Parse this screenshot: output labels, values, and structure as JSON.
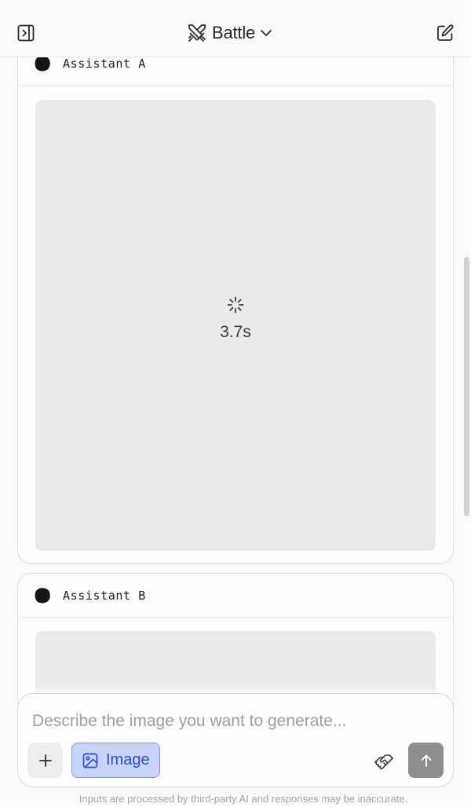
{
  "header": {
    "mode_label": "Battle",
    "icons": {
      "sidebar_toggle": "sidebar-toggle-icon",
      "mode": "crossed-swords-icon",
      "dropdown": "chevron-down-icon",
      "new_chat": "edit-square-icon"
    }
  },
  "responses": [
    {
      "model_name": "Assistant A",
      "status": "loading",
      "elapsed": "3.7s"
    },
    {
      "model_name": "Assistant B",
      "status": "loading"
    }
  ],
  "composer": {
    "placeholder": "Describe the image you want to generate...",
    "value": "",
    "image_mode_label": "Image",
    "image_mode_active": true,
    "icons": {
      "attach": "plus-icon",
      "image_mode": "image-icon",
      "feedback": "handshake-icon",
      "send": "arrow-up-icon"
    }
  },
  "footer": {
    "disclaimer": "Inputs are processed by third-party AI and responses may be inaccurate."
  },
  "colors": {
    "background": "#fbfbfb",
    "image_placeholder": "#e9e9eb",
    "image_mode_bg": "#c7d3fb",
    "image_mode_border": "#7f96e8",
    "image_mode_text": "#2e4fc7",
    "send_disabled": "#8e8e91"
  }
}
